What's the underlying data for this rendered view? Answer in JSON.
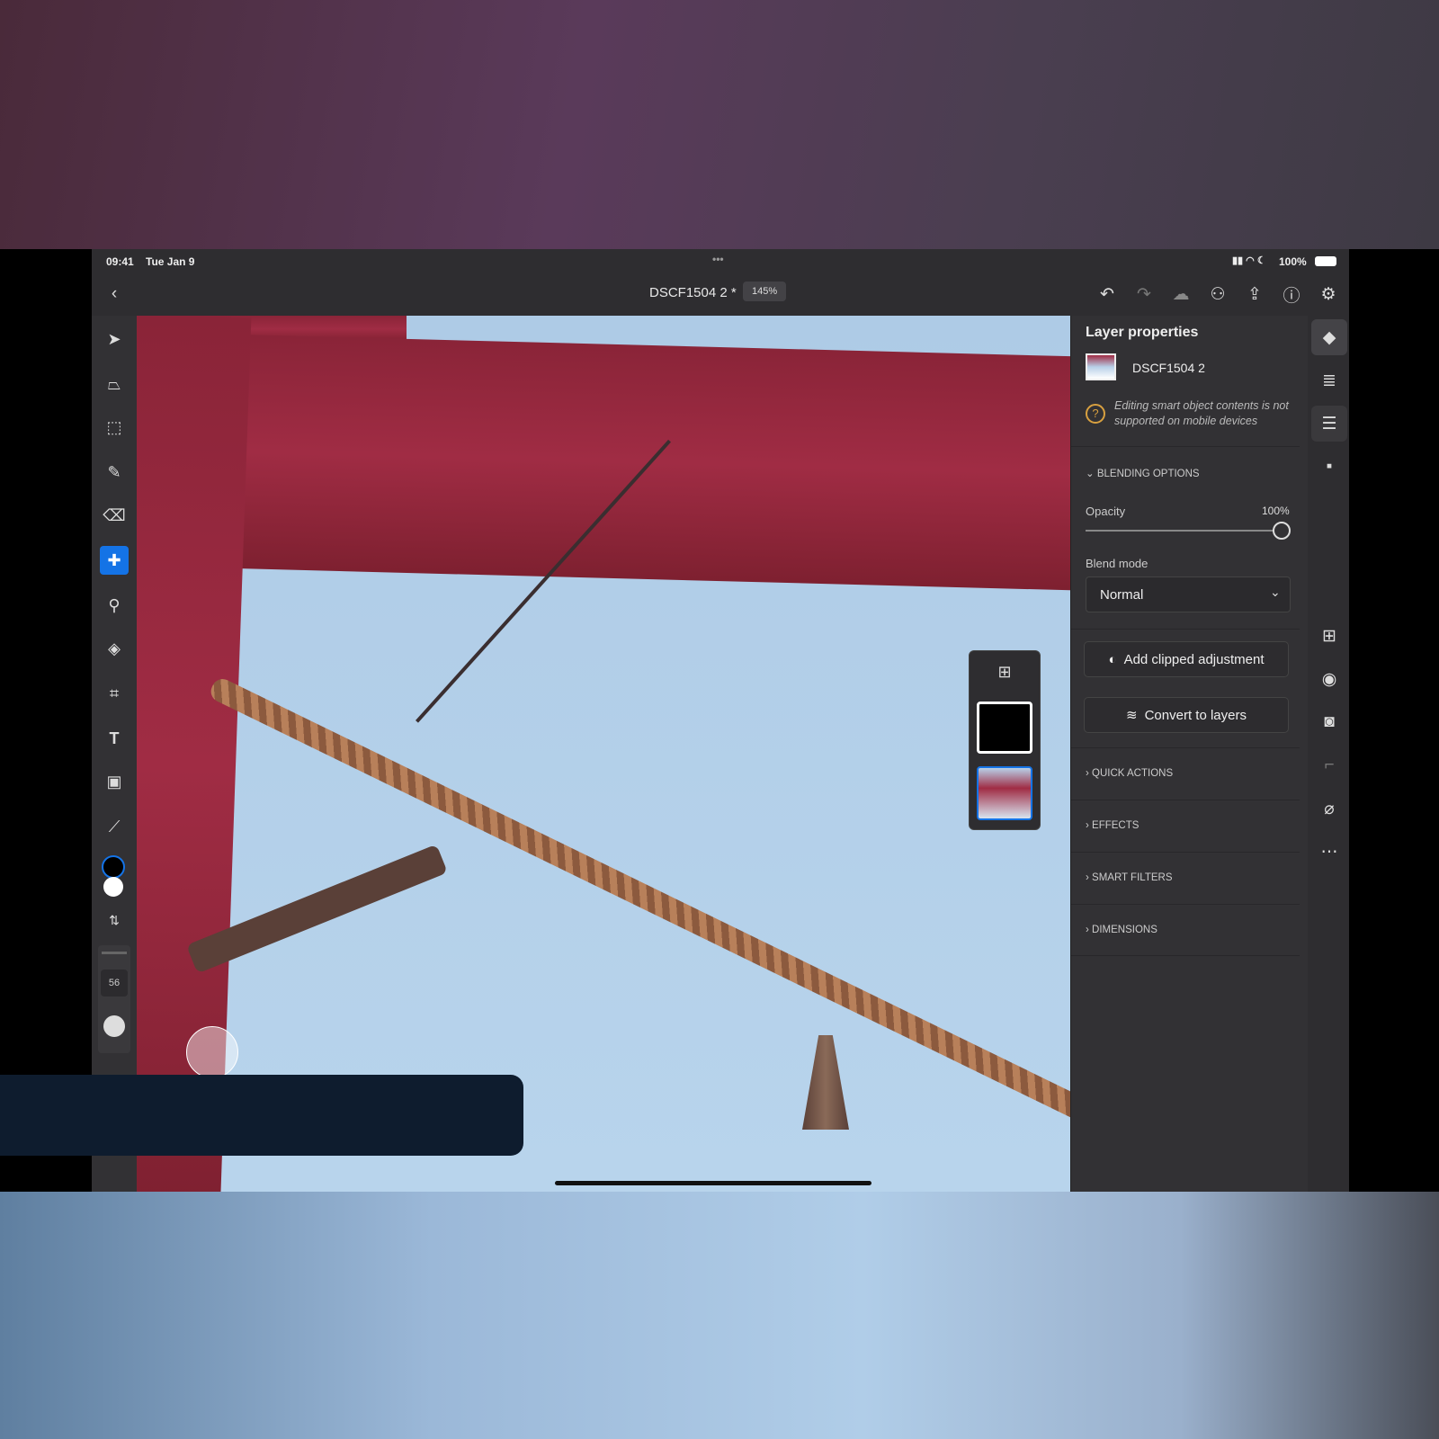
{
  "status": {
    "time": "09:41",
    "date": "Tue Jan 9",
    "dots": "•••",
    "battery": "100%"
  },
  "topbar": {
    "back_icon": "chevron-left-icon",
    "doc_title": "DSCF1504 2 *",
    "zoom": "145%",
    "icons": [
      "undo-icon",
      "redo-icon",
      "cloud-icon",
      "invite-user-icon",
      "share-icon",
      "help-icon",
      "gear-icon"
    ]
  },
  "toolbar": {
    "tools": [
      "select-arrow",
      "transform",
      "selection",
      "brush",
      "eraser",
      "healing-brush",
      "clone-stamp",
      "paint-bucket",
      "crop",
      "type",
      "place-image",
      "eyedropper"
    ],
    "active": "healing-brush",
    "fg_color": "#000000",
    "bg_color": "#ffffff",
    "brush_size": "56"
  },
  "panel": {
    "title": "Layer properties",
    "layer_name": "DSCF1504 2",
    "warning": "Editing smart object contents is not supported on mobile devices",
    "blending": "BLENDING OPTIONS",
    "opacity_label": "Opacity",
    "opacity": "100%",
    "opacity_value": 100,
    "blend_label": "Blend mode",
    "blend_value": "Normal",
    "add_clipped": "Add clipped adjustment",
    "convert": "Convert to layers",
    "sections": [
      "QUICK ACTIONS",
      "EFFECTS",
      "SMART FILTERS",
      "DIMENSIONS"
    ]
  },
  "rail": {
    "icons": [
      "layers-icon",
      "layer-stack-icon",
      "properties-icon",
      "comment-icon",
      "add-layer-icon",
      "visibility-icon",
      "mask-icon",
      "clip-icon",
      "eraser-layer-icon",
      "more-icon"
    ]
  },
  "colors": {
    "accent": "#1473e6",
    "panel": "#323134"
  }
}
